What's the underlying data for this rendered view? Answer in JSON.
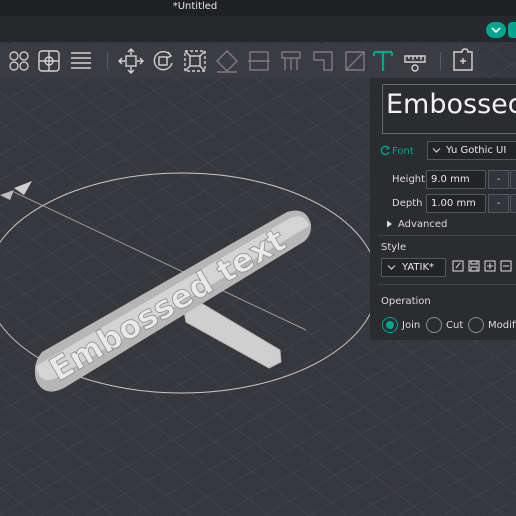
{
  "window": {
    "title": "*Untitled"
  },
  "viewport": {
    "model_text": "Embossed text"
  },
  "toolbar": {
    "tools": [
      "arrange-icon",
      "orient-icon",
      "layers-icon",
      "move-icon",
      "rotate-icon",
      "scale-icon",
      "lay-on-face-icon",
      "cut-icon",
      "support-paint-icon",
      "seam-paint-icon",
      "color-paint-icon",
      "emboss-text-icon",
      "measure-icon",
      "assembly-icon"
    ],
    "active_tool": "emboss-text-icon"
  },
  "emboss_panel": {
    "text_value": "Embossed",
    "font_label": "Font",
    "font_value": "Yu Gothic UI",
    "height_label": "Height",
    "height_value": "9.0 mm",
    "depth_label": "Depth",
    "depth_value": "1.00 mm",
    "decrement_label": "-",
    "advanced_label": "Advanced",
    "style_label": "Style",
    "style_value": "YATIK*",
    "operation_label": "Operation",
    "operation_options": [
      "Join",
      "Cut",
      "Modifi"
    ],
    "selected_operation": "Join"
  },
  "colors": {
    "accent": "#00a58e",
    "background": "#37383d",
    "panel": "#2b2c30"
  }
}
